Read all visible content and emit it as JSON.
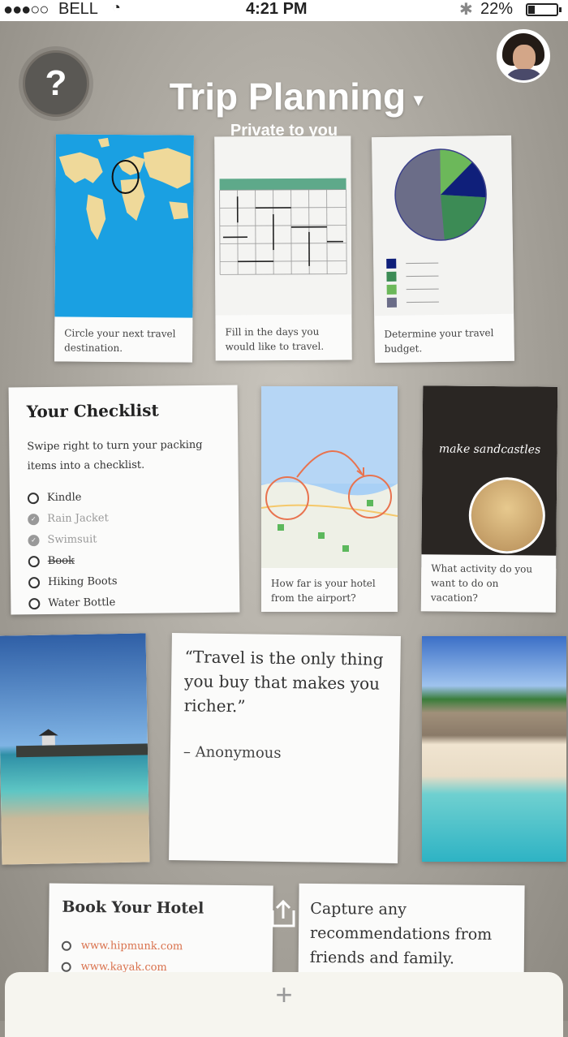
{
  "status_bar": {
    "signal": "●●●○○",
    "carrier": "BELL",
    "time": "4:21 PM",
    "battery": "22%"
  },
  "header": {
    "help_label": "?",
    "title": "Trip Planning",
    "title_caret": "▾",
    "subtitle": "Private to you"
  },
  "cards": {
    "map_caption": "Circle your next travel destination.",
    "calendar_caption": "Fill in the days you would like to travel.",
    "budget_caption": "Determine your travel budget.",
    "checklist": {
      "title": "Your Checklist",
      "description": "Swipe right to turn your packing items into a checklist.",
      "items": [
        {
          "label": "Kindle",
          "done": false,
          "strike": false
        },
        {
          "label": "Rain Jacket",
          "done": true,
          "strike": false
        },
        {
          "label": "Swimsuit",
          "done": true,
          "strike": false
        },
        {
          "label": "Book",
          "done": false,
          "strike": true
        },
        {
          "label": "Hiking Boots",
          "done": false,
          "strike": false
        },
        {
          "label": "Water Bottle",
          "done": false,
          "strike": false
        }
      ]
    },
    "airport_caption": "How far is your hotel from the airport?",
    "sandcastle_title": "make sandcastles",
    "sandcastle_caption": "What activity do you want to do on vacation?",
    "quote_text": "“Travel is the only thing you buy that makes you richer.”",
    "quote_author": "– Anonymous",
    "hotel": {
      "title": "Book Your Hotel",
      "links": [
        "www.hipmunk.com",
        "www.kayak.com"
      ]
    },
    "recommendations_text": "Capture any recommendations from friends and family."
  },
  "bottom_bar": {
    "add_label": "+"
  },
  "colors": {
    "map_ocean": "#1aa0e2",
    "land": "#efd99a",
    "pie_gray": "#6b6d88",
    "pie_light_green": "#6cb85a",
    "pie_navy": "#0f1f7a",
    "pie_green": "#3c8b55",
    "link": "#d9714c"
  }
}
